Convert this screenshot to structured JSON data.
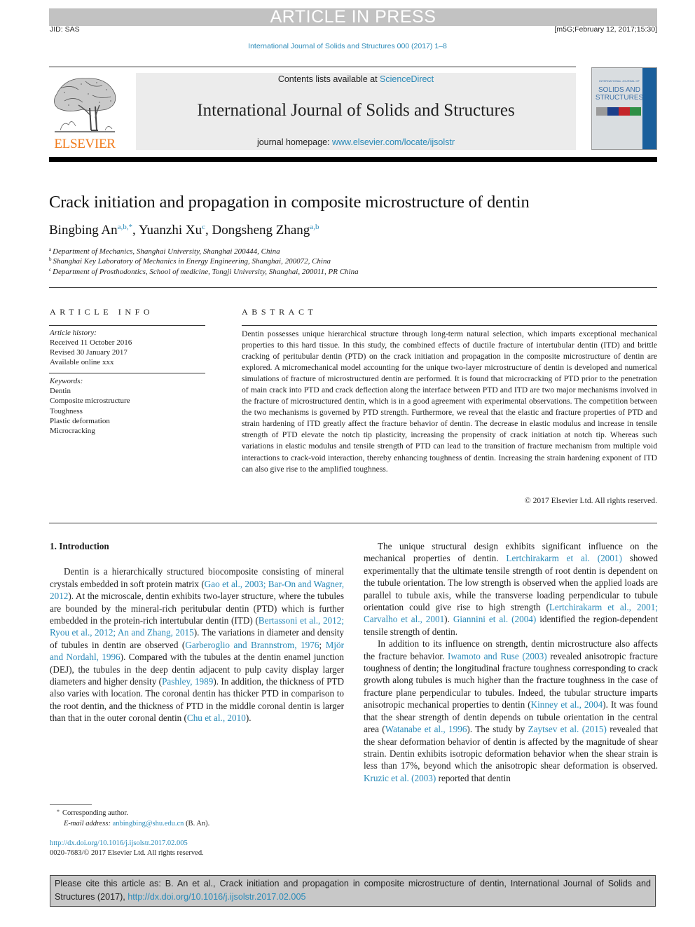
{
  "banner": {
    "text": "ARTICLE IN PRESS",
    "jid": "JID: SAS",
    "stamp": "[m5G;February 12, 2017;15:30]",
    "journal_ref": "International Journal of Solids and Structures 000 (2017) 1–8"
  },
  "header": {
    "publisher_word": "ELSEVIER",
    "contents_prefix": "Contents lists available at ",
    "contents_link": "ScienceDirect",
    "journal_title": "International Journal of Solids and Structures",
    "homepage_prefix": "journal homepage: ",
    "homepage_link": "www.elsevier.com/locate/ijsolstr",
    "cover": {
      "small_line": "INTERNATIONAL JOURNAL OF",
      "line1": "SOLIDS AND",
      "line2": "STRUCTURES",
      "strip_colors": [
        "#9a9a9a",
        "#1c3f8a",
        "#c4252a",
        "#2f8f45"
      ]
    },
    "colors": {
      "elsevier_orange": "#f07b1b",
      "link_blue": "#2a8ab8",
      "banner_gray": "#c2c2c2"
    }
  },
  "article": {
    "title": "Crack initiation and propagation in composite microstructure of dentin",
    "authors": [
      {
        "name": "Bingbing An",
        "sup": "a,b,*"
      },
      {
        "name": "Yuanzhi Xu",
        "sup": "c"
      },
      {
        "name": "Dongsheng Zhang",
        "sup": "a,b"
      }
    ],
    "author_separator": ", ",
    "affiliations": [
      {
        "key": "a",
        "text": "Department of Mechanics, Shanghai University, Shanghai 200444, China"
      },
      {
        "key": "b",
        "text": "Shanghai Key Laboratory of Mechanics in Energy Engineering, Shanghai, 200072, China"
      },
      {
        "key": "c",
        "text": "Department of Prosthodontics, School of medicine, Tongji University, Shanghai, 200011, PR China"
      }
    ]
  },
  "article_info": {
    "heading": "ARTICLE INFO",
    "history_label": "Article history:",
    "history": [
      "Received 11 October 2016",
      "Revised 30 January 2017",
      "Available online xxx"
    ],
    "keywords_label": "Keywords:",
    "keywords": [
      "Dentin",
      "Composite microstructure",
      "Toughness",
      "Plastic deformation",
      "Microcracking"
    ]
  },
  "abstract": {
    "heading": "ABSTRACT",
    "text": "Dentin possesses unique hierarchical structure through long-term natural selection, which imparts ex­ceptional mechanical properties to this hard tissue. In this study, the combined effects of ductile fracture of intertubular dentin (ITD) and brittle cracking of peritubular dentin (PTD) on the crack initiation and propagation in the composite microstructure of dentin are explored. A micromechanical model account­ing for the unique two-layer microstructure of dentin is developed and numerical simulations of fracture of microstructured dentin are performed. It is found that microcracking of PTD prior to the penetration of main crack into PTD and crack deflection along the interface between PTD and ITD are two major mechanisms involved in the fracture of microstructured dentin, which is in a good agreement with ex­perimental observations. The competition between the two mechanisms is governed by PTD strength. Furthermore, we reveal that the elastic and fracture properties of PTD and strain hardening of ITD greatly affect the fracture behavior of dentin. The decrease in elastic modulus and increase in tensile strength of PTD elevate the notch tip plasticity, increasing the propensity of crack initiation at notch tip. Whereas such variations in elastic modulus and tensile strength of PTD can lead to the transition of fracture mech­anism from multiple void interactions to crack-void interaction, thereby enhancing toughness of dentin. Increasing the strain hardening exponent of ITD can also give rise to the amplified toughness.",
    "copyright": "© 2017 Elsevier Ltd. All rights reserved."
  },
  "body": {
    "section_heading": "1. Introduction",
    "left_paragraph": [
      {
        "t": "Dentin is a hierarchically structured biocomposite consisting of mineral crystals embedded in soft protein matrix ("
      },
      {
        "link": "Gao et al., 2003; Bar-On and Wagner, 2012"
      },
      {
        "t": "). At the microscale, dentin ex­hibits two-layer structure, where the tubules are bounded by the mineral-rich peritubular dentin (PTD) which is further embed­ded in the protein-rich intertubular dentin (ITD) ("
      },
      {
        "link": "Bertassoni et al., 2012; Ryou et al., 2012; An and Zhang, 2015"
      },
      {
        "t": "). The variations in di­ameter and density of tubules in dentin are observed ("
      },
      {
        "link": "Garberoglio and Brannstrom, 1976"
      },
      {
        "t": "; "
      },
      {
        "link": "Mjör and Nordahl, 1996"
      },
      {
        "t": "). Compared with the tubules at the dentin enamel junction (DEJ), the tubules in the deep dentin adjacent to pulp cavity display larger diameters and higher density ("
      },
      {
        "link": "Pashley, 1989"
      },
      {
        "t": "). In addition, the thickness of PTD also varies with location. The coronal dentin has thicker PTD in comparison to the root dentin, and the thickness of PTD in the middle coronal dentin is larger than that in the outer coronal dentin ("
      },
      {
        "link": "Chu et al., 2010"
      },
      {
        "t": ")."
      }
    ],
    "right_paragraph_1": [
      {
        "t": "The unique structural design exhibits significant influence on the mechanical properties of dentin. "
      },
      {
        "link": "Lertchirakarm et al. (2001)"
      },
      {
        "t": " showed experimentally that the ultimate tensile strength of root dentin is dependent on the tubule orientation. The low strength is observed when the applied loads are parallel to tubule axis, while the transverse loading perpendicular to tubule orien­tation could give rise to high strength ("
      },
      {
        "link": "Lertchirakarm et al., 2001; Carvalho et al., 2001"
      },
      {
        "t": "). "
      },
      {
        "link": "Giannini et al. (2004)"
      },
      {
        "t": " identified the region-dependent tensile strength of dentin."
      }
    ],
    "right_paragraph_2": [
      {
        "t": "In addition to its influence on strength, dentin microstructure also affects the fracture behavior. "
      },
      {
        "link": "Iwamoto and Ruse (2003)"
      },
      {
        "t": " re­vealed anisotropic fracture toughness of dentin; the longitudinal fracture toughness corresponding to crack growth along tubules is much higher than the fracture toughness in the case of fracture plane perpendicular to tubules. Indeed, the tubular structure im­parts anisotropic mechanical properties to dentin ("
      },
      {
        "link": "Kinney et al., 2004"
      },
      {
        "t": "). It was found that the shear strength of dentin depends on tubule orientation in the central area ("
      },
      {
        "link": "Watanabe et al., 1996"
      },
      {
        "t": "). The study by "
      },
      {
        "link": "Zaytsev et al. (2015)"
      },
      {
        "t": " revealed that the shear defor­mation behavior of dentin is affected by the magnitude of shear strain. Dentin exhibits isotropic deformation behavior when the shear strain is less than 17%, beyond which the anisotropic shear deformation is observed. "
      },
      {
        "link": "Kruzic et al. (2003)"
      },
      {
        "t": " reported that dentin"
      }
    ]
  },
  "footnotes": {
    "corresponding_mark": "*",
    "corresponding": "Corresponding author.",
    "email_label": "E-mail address: ",
    "email": "anbingbing@shu.edu.cn",
    "email_suffix": " (B. An).",
    "doi": "http://dx.doi.org/10.1016/j.ijsolstr.2017.02.005",
    "issn_line": "0020-7683/© 2017 Elsevier Ltd. All rights reserved."
  },
  "cite_box": {
    "text": "Please cite this article as: B. An et al., Crack initiation and propagation in composite microstructure of dentin, International Journal of Solids and Structures (2017), ",
    "doi_link": "http://dx.doi.org/10.1016/j.ijsolstr.2017.02.005"
  }
}
